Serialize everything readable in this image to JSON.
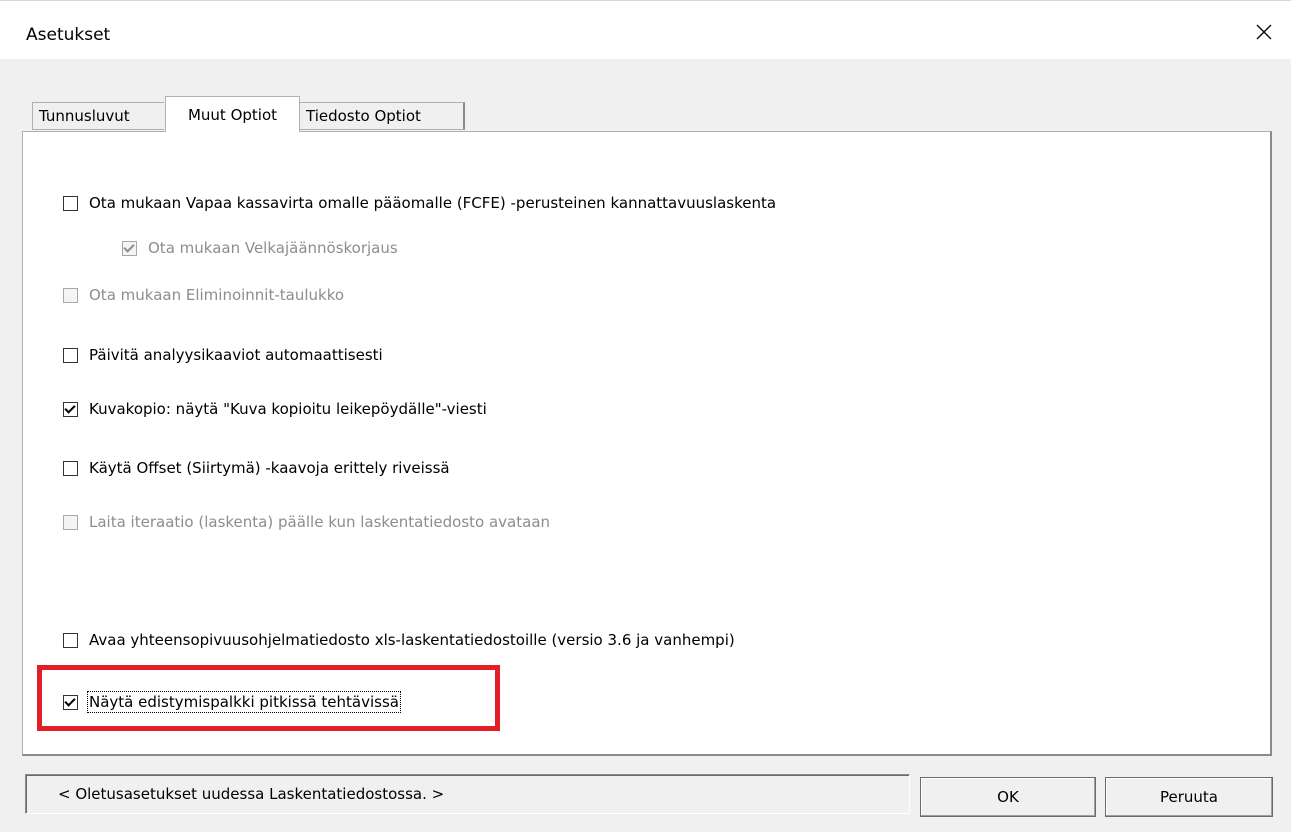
{
  "window": {
    "title": "Asetukset",
    "close_glyph": "✕"
  },
  "tabs": [
    {
      "label": "Tunnusluvut",
      "active": false
    },
    {
      "label": "Muut Optiot",
      "active": true
    },
    {
      "label": "Tiedosto Optiot",
      "active": false
    }
  ],
  "options": [
    {
      "label": "Ota mukaan Vapaa kassavirta omalle pääomalle (FCFE) -perusteinen kannattavuuslaskenta",
      "checked": false,
      "enabled": true
    },
    {
      "label": "Ota mukaan Velkajäännöskorjaus",
      "checked": true,
      "enabled": false
    },
    {
      "label": "Ota mukaan Eliminoinnit-taulukko",
      "checked": false,
      "enabled": false
    },
    {
      "label": "Päivitä analyysikaaviot automaattisesti",
      "checked": false,
      "enabled": true
    },
    {
      "label": "Kuvakopio: näytä \"Kuva kopioitu leikepöydälle\"-viesti",
      "checked": true,
      "enabled": true
    },
    {
      "label": "Käytä Offset (Siirtymä) -kaavoja erittely riveissä",
      "checked": false,
      "enabled": true
    },
    {
      "label": "Laita iteraatio (laskenta) päälle kun laskentatiedosto avataan",
      "checked": false,
      "enabled": false
    },
    {
      "label": "Avaa yhteensopivuusohjelmatiedosto xls-laskentatiedostoille (versio 3.6 ja vanhempi)",
      "checked": false,
      "enabled": true
    },
    {
      "label": "Näytä edistymispalkki pitkissä tehtävissä",
      "checked": true,
      "enabled": true
    }
  ],
  "footer": {
    "status_text": "< Oletusasetukset uudessa Laskentatiedostossa. >",
    "ok_label": "OK",
    "cancel_label": "Peruuta"
  },
  "highlight_color": "#e21e26"
}
